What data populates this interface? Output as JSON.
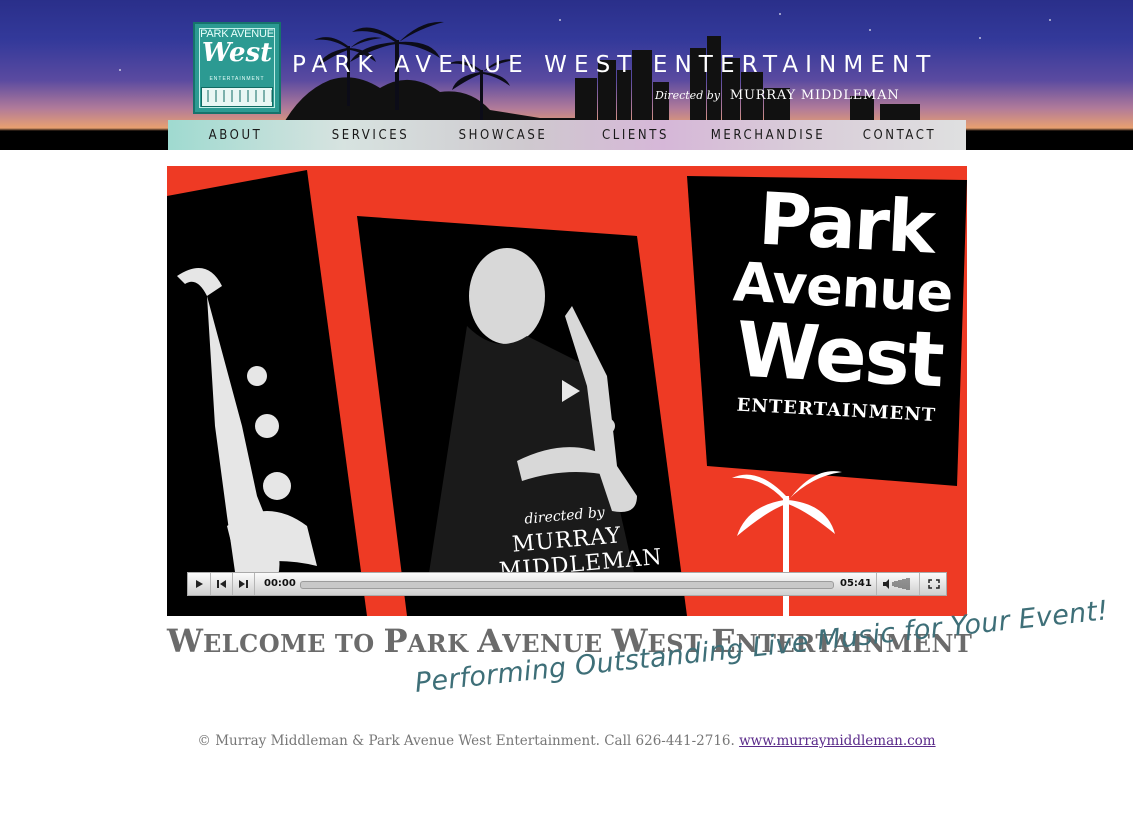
{
  "header": {
    "title": "PARK AVENUE WEST ENTERTAINMENT",
    "subtitle_directed": "Directed by",
    "subtitle_name": "MURRAY MIDDLEMAN",
    "logo": {
      "line1": "PARK AVENUE",
      "line2": "West",
      "line3": "ENTERTAINMENT"
    }
  },
  "nav": {
    "items": [
      {
        "label": "ABOUT"
      },
      {
        "label": "SERVICES"
      },
      {
        "label": "SHOWCASE"
      },
      {
        "label": "CLIENTS"
      },
      {
        "label": "MERCHANDISE"
      },
      {
        "label": "CONTACT"
      }
    ]
  },
  "video": {
    "poster": {
      "line1": "Park",
      "line2": "Avenue",
      "line3": "West",
      "line4": "ENTERTAINMENT",
      "directed_by": "directed by",
      "director": "MURRAY MIDDLEMAN"
    },
    "player": {
      "current_time": "00:00",
      "total_time": "05:41",
      "progress": 0
    }
  },
  "welcome": {
    "heading_parts": [
      {
        "cap": "W",
        "rest": "ELCOME TO "
      },
      {
        "cap": "P",
        "rest": "ARK "
      },
      {
        "cap": "A",
        "rest": "VENUE "
      },
      {
        "cap": "W",
        "rest": "EST "
      },
      {
        "cap": "E",
        "rest": "NTERTAINMENT"
      }
    ],
    "tagline": "Performing Outstanding Live Music for Your Event!"
  },
  "footer": {
    "text": "© Murray Middleman & Park Avenue West Entertainment. Call 626-441-2716.",
    "link_text": "www.murraymiddleman.com"
  },
  "colors": {
    "nav_text": "#1a1a1a",
    "poster_red": "#ee3a24",
    "heading_gray": "#6b6b6b",
    "tagline_teal": "#3e6f78",
    "footer_link": "#5a2a8a"
  }
}
